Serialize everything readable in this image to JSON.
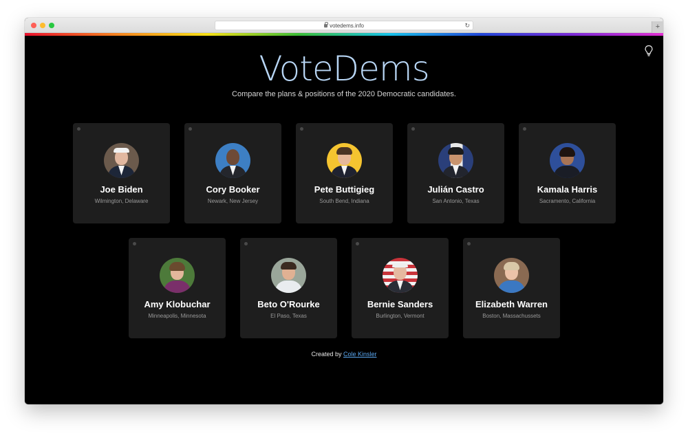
{
  "browser": {
    "url": "votedems.info"
  },
  "header": {
    "title": "VoteDems",
    "subtitle": "Compare the plans & positions of the 2020 Democratic candidates."
  },
  "candidates": [
    {
      "name": "Joe Biden",
      "location": "Wilmington, Delaware"
    },
    {
      "name": "Cory Booker",
      "location": "Newark, New Jersey"
    },
    {
      "name": "Pete Buttigieg",
      "location": "South Bend, Indiana"
    },
    {
      "name": "Julián Castro",
      "location": "San Antonio, Texas"
    },
    {
      "name": "Kamala Harris",
      "location": "Sacramento, California"
    },
    {
      "name": "Amy Klobuchar",
      "location": "Minneapolis, Minnesota"
    },
    {
      "name": "Beto O'Rourke",
      "location": "El Paso, Texas"
    },
    {
      "name": "Bernie Sanders",
      "location": "Burlington, Vermont"
    },
    {
      "name": "Elizabeth Warren",
      "location": "Boston, Massachussets"
    }
  ],
  "footer": {
    "prefix": "Created by",
    "author": "Cole Kinsler"
  },
  "colors": {
    "title": "#b8d6f5",
    "card_bg": "#1e1e1e",
    "link": "#5aa7f0"
  }
}
